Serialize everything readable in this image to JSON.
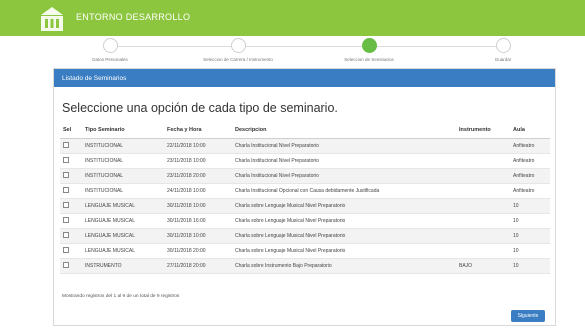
{
  "app": {
    "title": "ENTORNO DESARROLLO"
  },
  "colors": {
    "brand": "#8cc63f",
    "panel": "#3a7dc2",
    "active_step": "#67bd45"
  },
  "steps": [
    {
      "label": "Datos Personales",
      "active": false
    },
    {
      "label": "Seleccion de Carrera / Instrumento",
      "active": false
    },
    {
      "label": "Seleccion de Seminarios",
      "active": true
    },
    {
      "label": "Guardar",
      "active": false
    }
  ],
  "panel": {
    "title": "Listado de Seminarios",
    "heading": "Seleccione una opción de cada tipo de seminario."
  },
  "table": {
    "headers": [
      "Sel",
      "Tipo Seminario",
      "Fecha y Hora",
      "Descripcion",
      "Instrumento",
      "Aula"
    ],
    "rows": [
      {
        "tipo": "INSTITUCIONAL",
        "fecha": "22/11/2018 10:00",
        "desc": "Charla Institucional Nivel Preparatorio",
        "instrumento": "",
        "aula": "Anfiteatro"
      },
      {
        "tipo": "INSTITUCIONAL",
        "fecha": "23/11/2018 10:00",
        "desc": "Charla Institucional Nivel Preparatorio",
        "instrumento": "",
        "aula": "Anfiteatro"
      },
      {
        "tipo": "INSTITUCIONAL",
        "fecha": "23/11/2018 20:00",
        "desc": "Charla Institucional Nivel Preparatorio",
        "instrumento": "",
        "aula": "Anfiteatro"
      },
      {
        "tipo": "INSTITUCIONAL",
        "fecha": "24/11/2018 10:00",
        "desc": "Charla Institucional Opcional con Causa debidamente Justificada",
        "instrumento": "",
        "aula": "Anfiteatro"
      },
      {
        "tipo": "LENGUAJE MUSICAL",
        "fecha": "30/11/2018 10:00",
        "desc": "Charla sobre Lenguaje Musical Nivel Preparatorio",
        "instrumento": "",
        "aula": "10"
      },
      {
        "tipo": "LENGUAJE MUSICAL",
        "fecha": "30/11/2018 16:00",
        "desc": "Charla sobre Lenguaje Musical Nivel Preparatorio",
        "instrumento": "",
        "aula": "10"
      },
      {
        "tipo": "LENGUAJE MUSICAL",
        "fecha": "30/11/2018 10:00",
        "desc": "Charla sobre Lenguaje Musical Nivel Preparatorio",
        "instrumento": "",
        "aula": "10"
      },
      {
        "tipo": "LENGUAJE MUSICAL",
        "fecha": "30/11/2018 20:00",
        "desc": "Charla sobre Lenguaje Musical Nivel Preparatorio",
        "instrumento": "",
        "aula": "10"
      },
      {
        "tipo": "INSTRUMENTO",
        "fecha": "27/11/2018 20:00",
        "desc": "Charla sobre Instrumento Bajo Preparatorio",
        "instrumento": "BAJO",
        "aula": "10"
      }
    ]
  },
  "footer": {
    "info": "Mostrando registros del 1 al 9 de un total de 9 registros",
    "next_label": "Siguiente"
  }
}
